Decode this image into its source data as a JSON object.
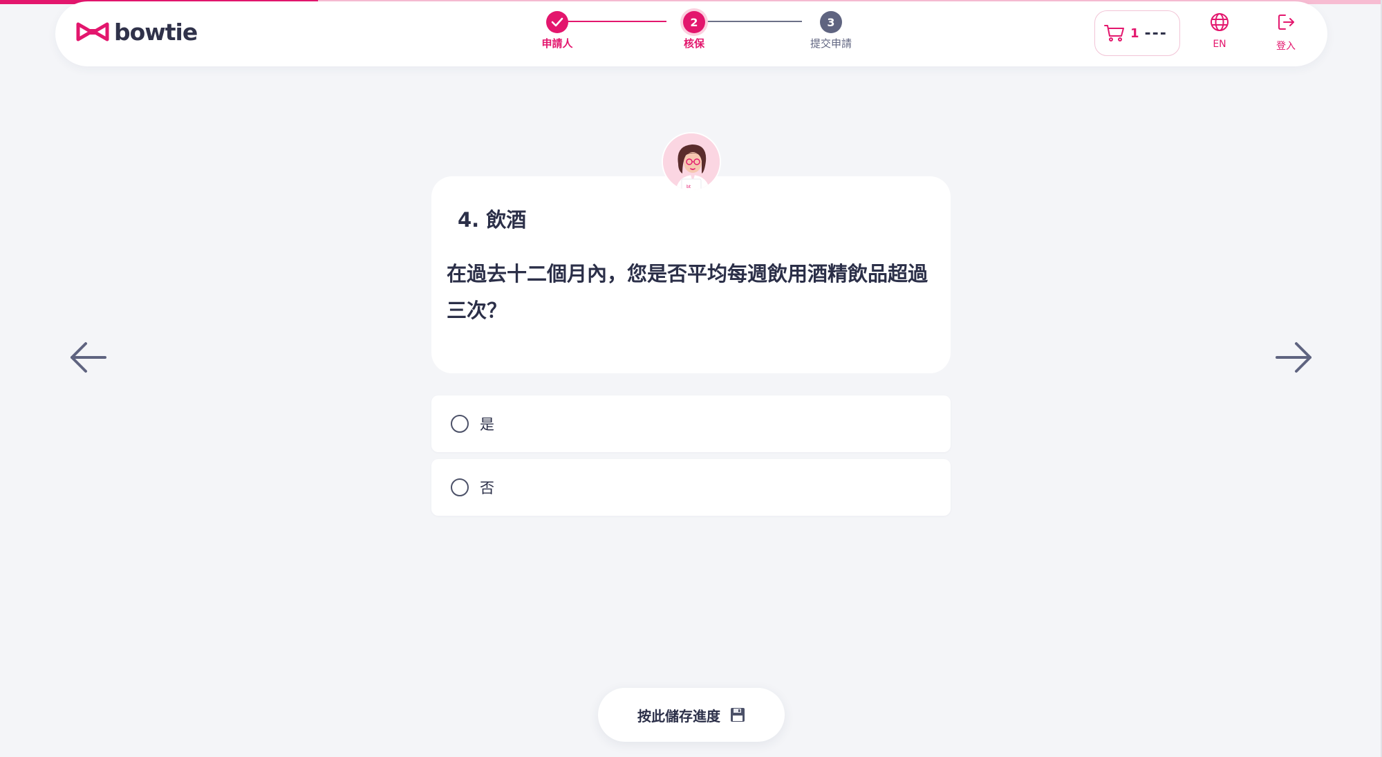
{
  "brand": {
    "name": "bowtie",
    "accent_color": "#e3166d",
    "dark_color": "#30324a"
  },
  "page_progress": 0.23,
  "stepper": {
    "steps": [
      {
        "number": "1",
        "label": "申請人",
        "state": "completed",
        "icon": "check-icon"
      },
      {
        "number": "2",
        "label": "核保",
        "state": "current"
      },
      {
        "number": "3",
        "label": "提交申請",
        "state": "upcoming"
      }
    ]
  },
  "cart": {
    "icon": "cart-icon",
    "count": "1",
    "amount": "---"
  },
  "language": {
    "icon": "globe-icon",
    "label": "EN"
  },
  "login": {
    "icon": "logout-icon",
    "label": "登入"
  },
  "question": {
    "title": "4. 飲酒",
    "text": "在過去十二個月內，您是否平均每週飲用酒精飲品超過三次？"
  },
  "options": [
    {
      "label": "是",
      "selected": false
    },
    {
      "label": "否",
      "selected": false
    }
  ],
  "navigation": {
    "prev_icon": "arrow-left-icon",
    "next_icon": "arrow-right-icon"
  },
  "save": {
    "label": "按此儲存進度",
    "icon": "floppy-disk-icon"
  }
}
